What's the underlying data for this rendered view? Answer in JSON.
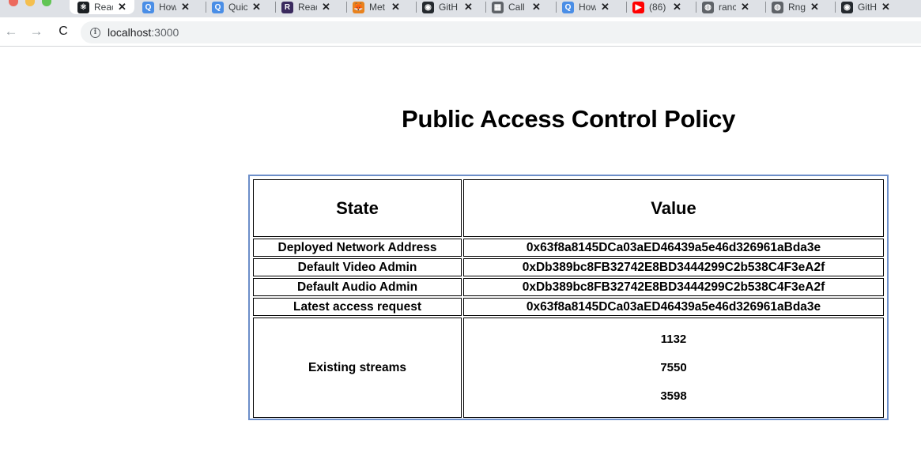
{
  "browser": {
    "tabs": [
      {
        "title": "Reac",
        "icon": "react-icon",
        "color": "#1b1f23",
        "glyph": "⚛",
        "active": true
      },
      {
        "title": "How",
        "icon": "q-icon",
        "color": "#4a8ee6",
        "glyph": "Q"
      },
      {
        "title": "Quic",
        "icon": "q-icon",
        "color": "#4a8ee6",
        "glyph": "Q"
      },
      {
        "title": "Reac",
        "icon": "r-icon",
        "color": "#3a2a5e",
        "glyph": "R"
      },
      {
        "title": "Met",
        "icon": "metamask-fox-icon",
        "color": "#e8821e",
        "glyph": "🦊"
      },
      {
        "title": "GitH",
        "icon": "github-icon",
        "color": "#24292e",
        "glyph": "◉"
      },
      {
        "title": "Call",
        "icon": "building-icon",
        "color": "#5f6368",
        "glyph": "▦"
      },
      {
        "title": "How",
        "icon": "q-icon",
        "color": "#4a8ee6",
        "glyph": "Q"
      },
      {
        "title": "(86)",
        "icon": "youtube-icon",
        "color": "#ff0000",
        "glyph": "▶"
      },
      {
        "title": "ranc",
        "icon": "globe-icon",
        "color": "#5f6368",
        "glyph": "◍"
      },
      {
        "title": "Rng",
        "icon": "globe-icon",
        "color": "#5f6368",
        "glyph": "◍"
      },
      {
        "title": "GitH",
        "icon": "github-icon",
        "color": "#24292e",
        "glyph": "◉"
      }
    ],
    "close_glyph": "✕",
    "url_host": "localhost",
    "url_port": ":3000",
    "nav": {
      "back": "←",
      "forward": "→",
      "reload": "C",
      "info": "i"
    }
  },
  "page": {
    "title": "Public Access Control Policy",
    "table": {
      "headers": [
        "State",
        "Value"
      ],
      "rows": [
        {
          "state": "Deployed Network Address",
          "value": "0x63f8a8145DCa03aED46439a5e46d326961aBda3e"
        },
        {
          "state": "Default Video Admin",
          "value": "0xDb389bc8FB32742E8BD3444299C2b538C4F3eA2f"
        },
        {
          "state": "Default Audio Admin",
          "value": "0xDb389bc8FB32742E8BD3444299C2b538C4F3eA2f"
        },
        {
          "state": "Latest access request",
          "value": "0x63f8a8145DCa03aED46439a5e46d326961aBda3e"
        }
      ],
      "streams": {
        "label": "Existing streams",
        "values": [
          "1132",
          "7550",
          "3598"
        ]
      }
    }
  }
}
